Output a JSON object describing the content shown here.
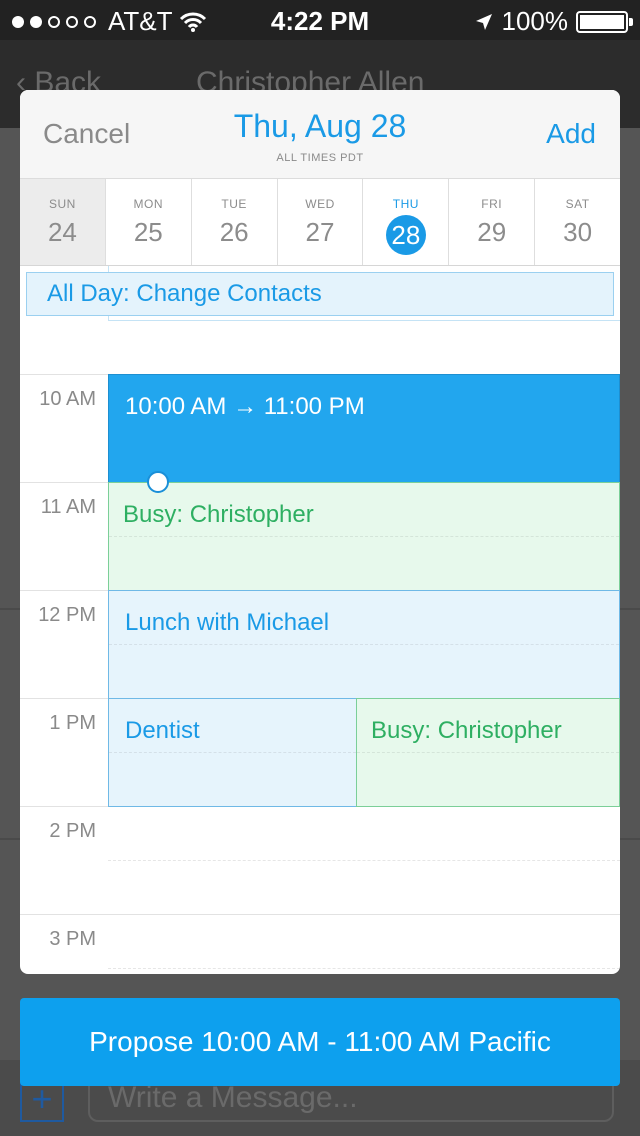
{
  "status_bar": {
    "carrier": "AT&T",
    "time": "4:22 PM",
    "battery": "100%",
    "signal_bars": 2,
    "battery_level": 1.0
  },
  "background": {
    "back_label": "Back",
    "contact_name": "Christopher Allen",
    "compose_placeholder": "Write a Message..."
  },
  "modal": {
    "cancel_label": "Cancel",
    "add_label": "Add",
    "date_title": "Thu, Aug 28",
    "timezone_note": "ALL TIMES PDT",
    "week": [
      {
        "name": "SUN",
        "date": "24"
      },
      {
        "name": "MON",
        "date": "25"
      },
      {
        "name": "TUE",
        "date": "26"
      },
      {
        "name": "WED",
        "date": "27"
      },
      {
        "name": "THU",
        "date": "28"
      },
      {
        "name": "FRI",
        "date": "29"
      },
      {
        "name": "SAT",
        "date": "30"
      }
    ],
    "all_day_event": "All Day: Change Contacts",
    "time_labels": [
      "10 AM",
      "11 AM",
      "12 PM",
      "1 PM",
      "2 PM",
      "3 PM"
    ],
    "events": {
      "selected": "10:00 AM → 11:00 PM",
      "busy_1": "Busy: Christopher",
      "lunch": "Lunch with Michael",
      "dentist": "Dentist",
      "busy_2": "Busy: Christopher"
    }
  },
  "propose_button": "Propose 10:00 AM - 11:00 AM Pacific",
  "colors": {
    "accent": "#1a9ae6",
    "selected_event": "#22a6ee",
    "busy_text": "#2eaf62",
    "button": "#0da0ee"
  }
}
